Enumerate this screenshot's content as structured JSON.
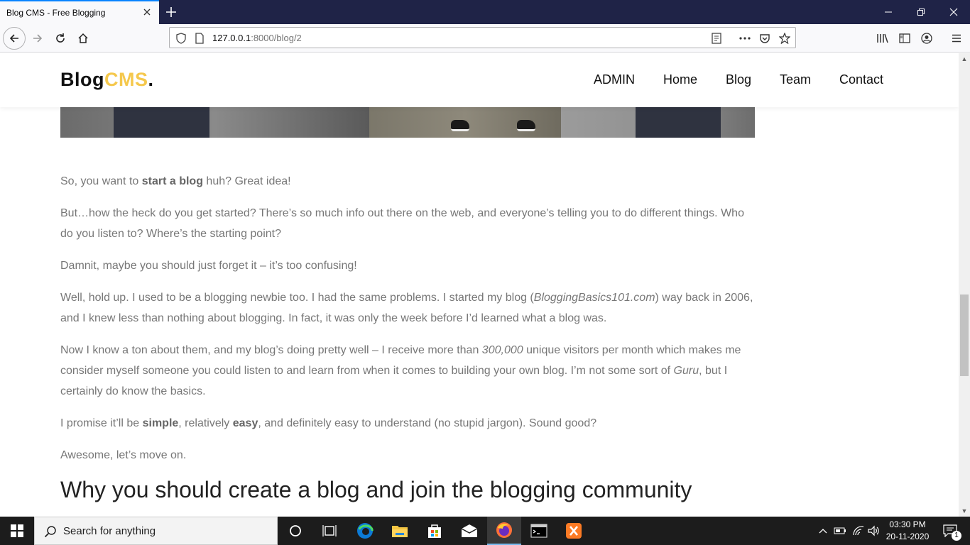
{
  "browser": {
    "tab_title": "Blog CMS - Free Blogging",
    "url_host": "127.0.0.1",
    "url_rest": ":8000/blog/2"
  },
  "site": {
    "logo_main": "Blog",
    "logo_accent": "CMS",
    "logo_dot": ".",
    "nav": [
      "ADMIN",
      "Home",
      "Blog",
      "Team",
      "Contact"
    ]
  },
  "article": {
    "p1": [
      "So, you want to ",
      "start a blog",
      " huh? Great idea!"
    ],
    "p2": "But…how the heck do you get started? There’s so much info out there on the web, and everyone’s telling you to do different things. Who do you listen to? Where’s the starting point?",
    "p3": "Damnit, maybe you should just forget it – it’s too confusing!",
    "p4": [
      "Well, hold up. I used to be a blogging newbie too. I had the same problems. I started my blog (",
      "BloggingBasics101.com",
      ") way back in 2006, and I knew less than nothing about blogging. In fact, it was only the week before I’d learned what a blog was."
    ],
    "p5": [
      "Now I know a ton about them, and my blog’s doing pretty well – I receive more than ",
      "300,000",
      " unique visitors per month which makes me consider myself someone you could listen to and learn from when it comes to building your own blog. I’m not some sort of ",
      "Guru",
      ", but I certainly do know the basics."
    ],
    "p6": [
      "I promise it’ll be ",
      "simple",
      ", relatively ",
      "easy",
      ", and definitely easy to understand (no stupid jargon). Sound good?"
    ],
    "p7": "Awesome, let’s move on.",
    "h2": "Why you should create a blog and join the blogging community"
  },
  "taskbar": {
    "search_placeholder": "Search for anything",
    "time": "03:30 PM",
    "date": "20-11-2020",
    "notification_count": "1"
  }
}
